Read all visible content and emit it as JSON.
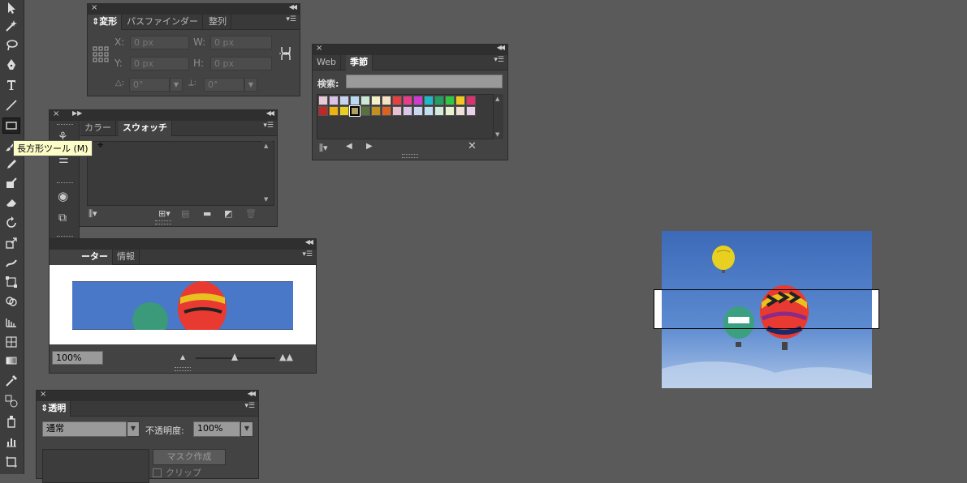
{
  "transform_panel": {
    "tabs": [
      "変形",
      "パスファインダー",
      "整列"
    ],
    "x_label": "X:",
    "y_label": "Y:",
    "w_label": "W:",
    "h_label": "H:",
    "x_value": "0 px",
    "y_value": "0 px",
    "w_value": "0 px",
    "h_value": "0 px",
    "angle_value": "0°",
    "shear_value": "0°"
  },
  "swatches_panel": {
    "tabs": [
      "カラー",
      "スウォッチ"
    ]
  },
  "navigator_panel": {
    "tabs": [
      "ナビゲーター",
      "情報"
    ],
    "zoom_value": "100%",
    "visible_tab_text": "ーター"
  },
  "library_panel": {
    "tabs": [
      "Web",
      "季節"
    ],
    "search_label": "検索:",
    "swatch_colors_row1": [
      "#e8c9d8",
      "#d9c3e6",
      "#c7d3ef",
      "#bcd9f2",
      "#cde9d5",
      "#f5f0c8",
      "#f7e2c2",
      "#e84040",
      "#e83c8c",
      "#d03ad0",
      "#1fb8c8",
      "#1fa060",
      "#30c840",
      "#f0c820",
      "#e03070"
    ],
    "swatch_colors_row2": [
      "#c02828",
      "#f0b010",
      "#e8d020",
      "#b0a060",
      "#5a7040",
      "#c09020",
      "#e06020",
      "#e8c0d0",
      "#d8c8e8",
      "#c8d8f0",
      "#c0e0f0",
      "#d0ecd8",
      "#e8f0d0",
      "#f0e0d8",
      "#e8d0e8"
    ]
  },
  "transparency_panel": {
    "tab": "透明",
    "blend_mode": "通常",
    "opacity_label": "不透明度:",
    "opacity_value": "100%",
    "mask_button": "マスク作成",
    "clip_label": "クリップ"
  },
  "tooltip": "長方形ツール (M)",
  "colors": {
    "bg": "#5a5a5a",
    "panel": "#434343",
    "sky": "#4a78c8"
  }
}
